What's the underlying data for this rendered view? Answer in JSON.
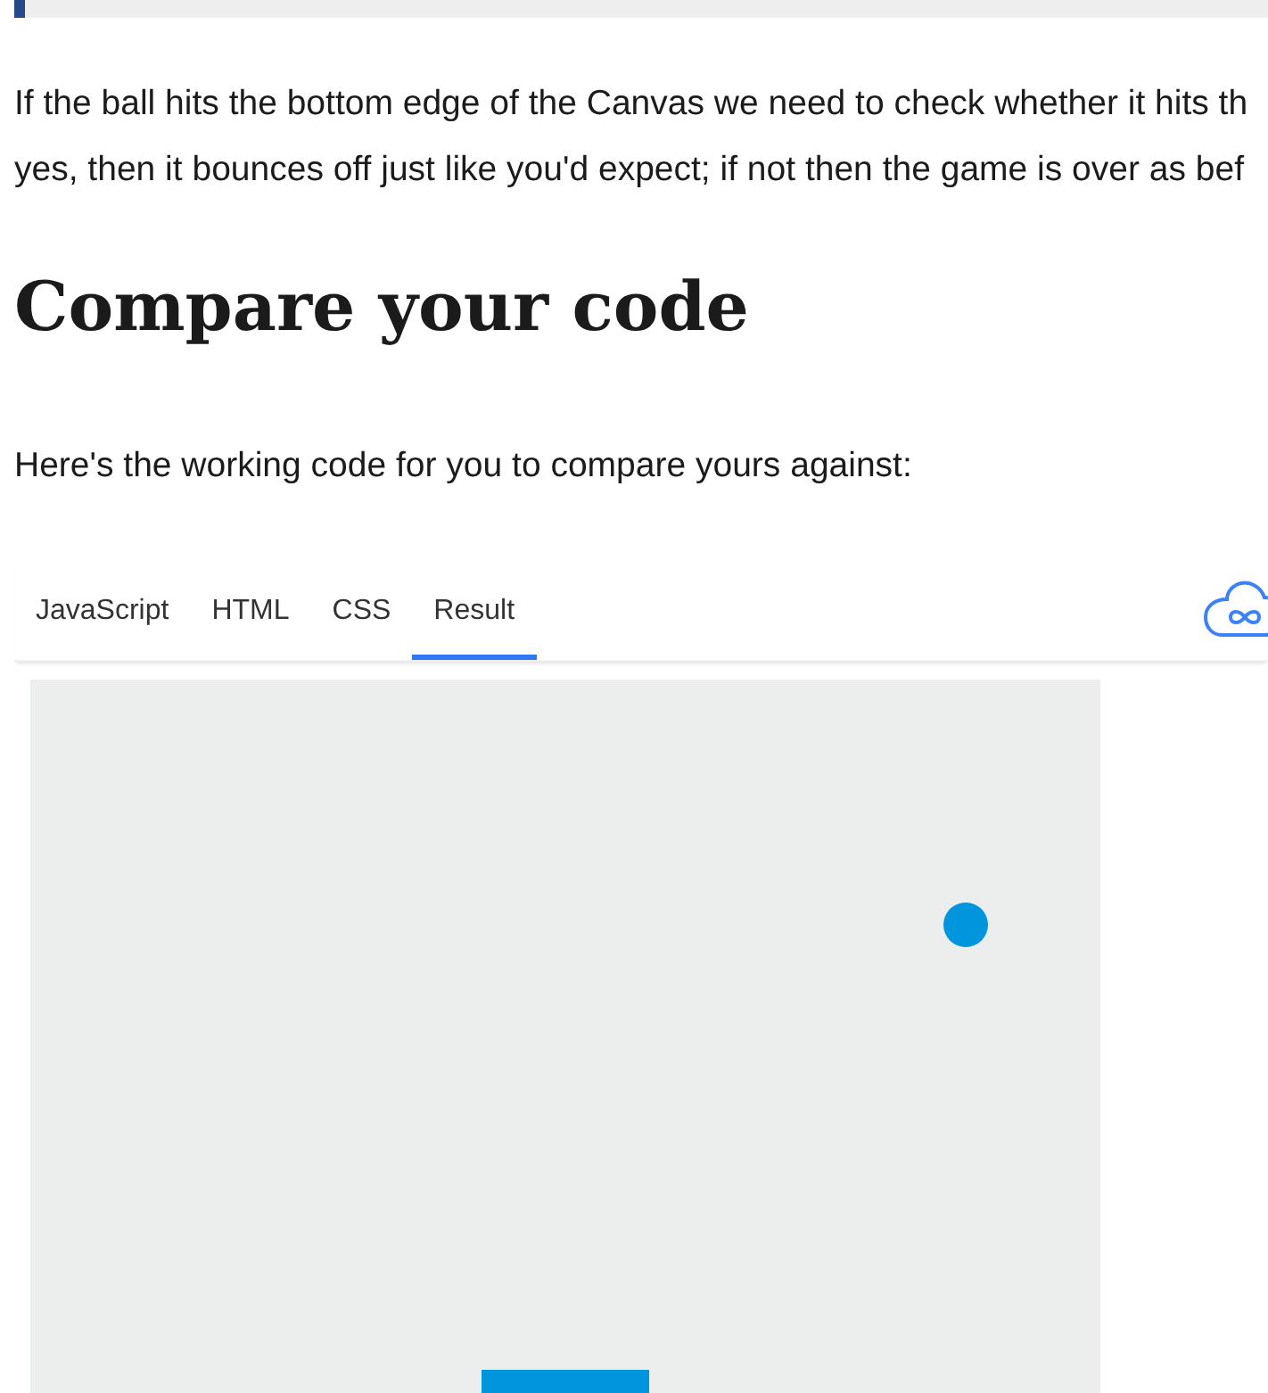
{
  "paragraph": {
    "lines": [
      "If the ball hits the bottom edge of the Canvas we need to check whether it hits th",
      "yes, then it bounces off just like you'd expect; if not then the game is over as bef"
    ]
  },
  "heading": "Compare your code",
  "lead_text": "Here's the working code for you to compare yours against:",
  "tabs": [
    {
      "label": "JavaScript",
      "selected": false
    },
    {
      "label": "HTML",
      "selected": false
    },
    {
      "label": "CSS",
      "selected": false
    },
    {
      "label": "Result",
      "selected": true
    }
  ]
}
